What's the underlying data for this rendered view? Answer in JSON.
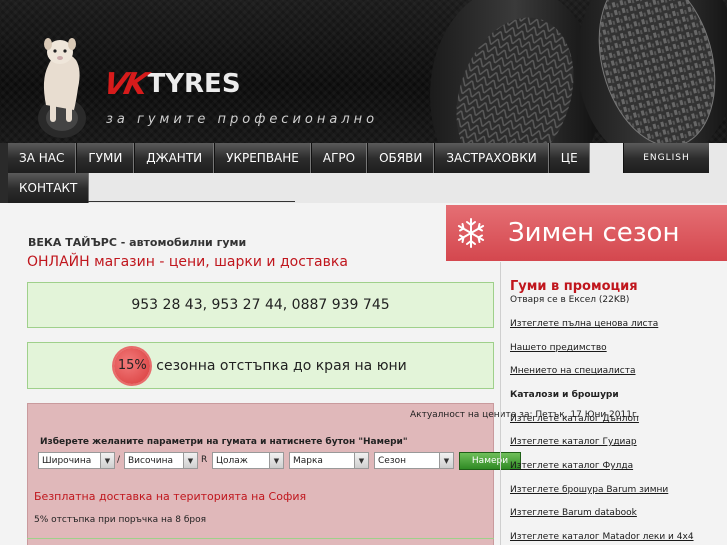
{
  "header": {
    "logo_vk": "VK",
    "logo_tyres": "TYRES",
    "slogan": "за гумите професионално"
  },
  "nav": {
    "row1": [
      "ЗА НАС",
      "ГУМИ",
      "ДЖАНТИ",
      "УКРЕПВАНЕ",
      "АГРО",
      "ОБЯВИ",
      "ЗАСТРАХОВКИ",
      "ЦЕ"
    ],
    "row2": [
      "КОНТАКТ"
    ],
    "language": "ENGLISH"
  },
  "intro": {
    "title": "ВЕКА ТАЙЪРС - автомобилни гуми",
    "subtitle": "ОНЛАЙН магазин - цени, шарки и доставка"
  },
  "phones": "953 28 43, 953 27 44, 0887 939 745",
  "discount": {
    "badge": "15%",
    "text": "сезонна отстъпка до края на юни"
  },
  "search": {
    "updated": "Актуалност на цените за: Петък, 17 Юни 2011г.",
    "instructions": "Изберете желаните параметри на гумата и натиснете бутон \"Намери\"",
    "width": "Широчина",
    "height": "Височина",
    "sep_slash": "/",
    "sep_r": "R",
    "rim": "Цолаж",
    "brand": "Марка",
    "season": "Сезон",
    "find_button": "Намери",
    "free_delivery": "Безплатна доставка на територията на София",
    "bulk_discount": "5% отстъпка при поръчка на 8 броя"
  },
  "sidebar": {
    "winter_banner": "Зимен сезон",
    "promo_title": "Гуми в промоция",
    "promo_sub": "Отваря се в Ексел (22KB)",
    "links_top": [
      "Изтеглете пълна ценова листа",
      "Нашето предимство",
      "Мнението на специалиста"
    ],
    "catalogs_heading": "Каталози и брошури",
    "catalog_links": [
      "Изтеглете каталог Дънлоп",
      "Изтеглете каталог Гудиар",
      "Изтеглете каталог Фулда",
      "Изтеглете брошура Barum зимни",
      "Изтеглете Barum databook",
      "Изтеглете каталог Matador леки и 4x4"
    ]
  },
  "colors": {
    "accent_red": "#c0161d",
    "promo_green": "#e3f4d9",
    "search_pink": "#e0b8ba",
    "winter_banner": "#d4474e"
  }
}
